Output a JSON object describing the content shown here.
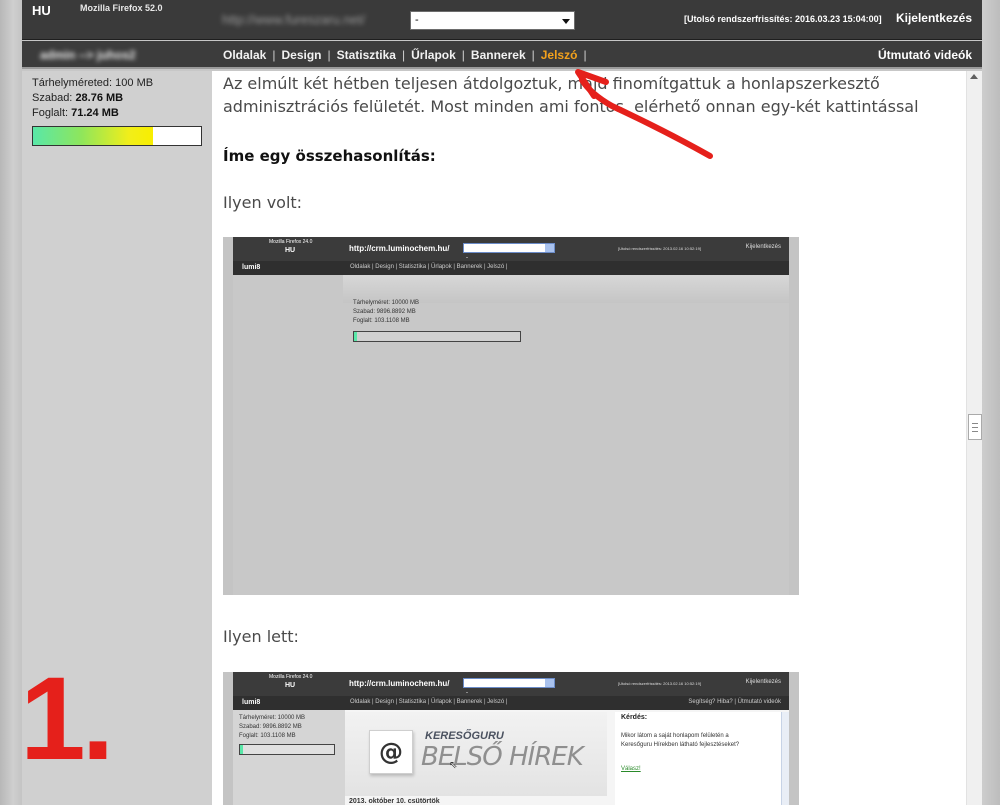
{
  "topbar": {
    "lang": "HU",
    "browser": "Mozilla Firefox 52.0",
    "site_url": "http://www.fureszaru.net/",
    "site_select_value": "-",
    "refresh": "[Utolsó rendszerfrissítés: 2016.03.23 15:04:00]",
    "logout": "Kijelentkezés"
  },
  "navbar": {
    "user": "admin --> juhos2",
    "menu": [
      {
        "label": "Oldalak"
      },
      {
        "label": "Design"
      },
      {
        "label": "Statisztika"
      },
      {
        "label": "Űrlapok"
      },
      {
        "label": "Bannerek"
      },
      {
        "label": "Jelszó",
        "active": true
      }
    ],
    "trailing_sep": "|",
    "guide": "Útmutató videók"
  },
  "storage": {
    "size_label": "Tárhelyméreted:",
    "size_value": "100 MB",
    "free_label": "Szabad:",
    "free_value": "28.76 MB",
    "used_label": "Foglalt:",
    "used_value": "71.24 MB",
    "used_fraction": 0.7124
  },
  "content": {
    "intro": "Az elmúlt két hétben teljesen átdolgoztuk, majd finomítgattuk a honlapszerkesztő adminisztrációs felületét. Most minden ami fontos, elérhető onnan egy-két kattintással",
    "heading": "Íme egy összehasonlítás:",
    "before_label": "Ilyen volt:",
    "after_label": "Ilyen lett:"
  },
  "old_shot": {
    "browser": "Mozilla Firefox 24.0",
    "lang": "HU",
    "url": "http://crm.luminochem.hu/",
    "select_value": "-",
    "refresh": "[Utolsó rendszerfrissítés: 2013.02.16 10:52:19]",
    "logout": "Kijelentkezés",
    "user": "lumi8",
    "menu": "Oldalak | Design | Statisztika | Űrlapok | Bannerek | Jelszó |",
    "storage_lines": [
      "Tárhelyméret: 10000 MB",
      "Szabad: 9896.8892 MB",
      "Foglalt: 103.1108 MB"
    ]
  },
  "new_shot": {
    "browser": "Mozilla Firefox 24.0",
    "lang": "HU",
    "url": "http://crm.luminochem.hu/",
    "select_value": "-",
    "refresh": "[Utolsó rendszerfrissítés: 2013.02.16 10:52:19]",
    "logout": "Kijelentkezés",
    "user": "lumi8",
    "menu": "Oldalak | Design | Statisztika | Űrlapok | Bannerek | Jelszó |",
    "guide": "Segítség? Hiba? | Útmutató videók",
    "storage_lines": [
      "Tárhelyméret: 10000 MB",
      "Szabad: 9896.8892 MB",
      "Foglalt: 103.1108 MB"
    ],
    "banner_at": "@",
    "banner_brand": "KERESŐGURU",
    "banner_title": "BELSŐ HÍREK",
    "date": "2013. október 10. csütörtök",
    "question_label": "Kérdés:",
    "question_text": "Mikor látom a saját honlapom felületén a Keresőguru Hírekben látható fejlesztéseket?",
    "answer_link": "Válasz!"
  },
  "annotation": {
    "number": "1.",
    "arrow_color": "#e5201b"
  }
}
